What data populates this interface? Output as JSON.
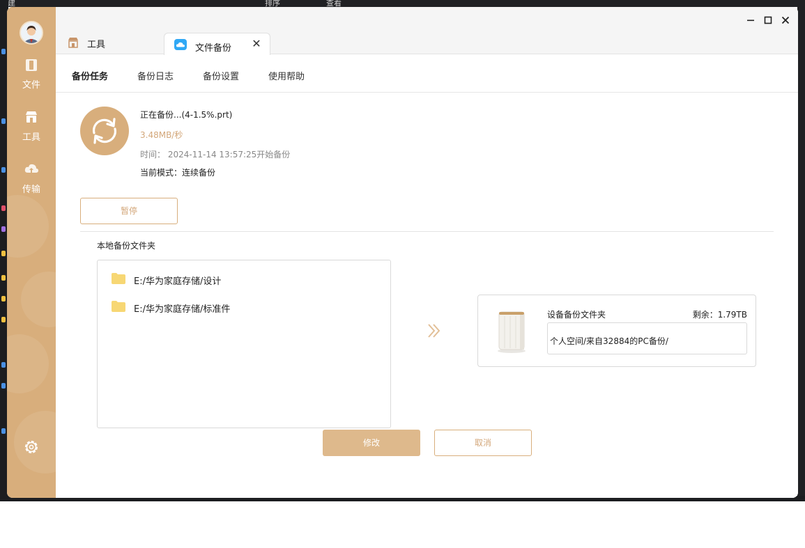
{
  "background": {
    "menu_items": [
      "新建",
      "排序",
      "查看"
    ]
  },
  "sidebar": {
    "items": [
      {
        "label": "文件",
        "icon": "file-icon"
      },
      {
        "label": "工具",
        "icon": "toolbox-icon"
      },
      {
        "label": "传输",
        "icon": "cloud-upload-icon"
      }
    ],
    "settings_icon": "gear-icon",
    "color": "#d8ae7c"
  },
  "tabs": [
    {
      "label": "工具",
      "icon": "store-icon"
    },
    {
      "label": "文件备份",
      "icon": "cloud-icon",
      "active": true
    }
  ],
  "subnav": [
    {
      "label": "备份任务",
      "active": true
    },
    {
      "label": "备份日志"
    },
    {
      "label": "备份设置"
    },
    {
      "label": "使用帮助"
    }
  ],
  "status": {
    "current": "正在备份...(4-1.5%.prt)",
    "speed": "3.48MB/秒",
    "time_label": "时间：",
    "time_value": "2024-11-14 13:57:25开始备份",
    "mode": "当前模式：连续备份"
  },
  "buttons": {
    "pause": "暂停",
    "modify": "修改",
    "cancel": "取消"
  },
  "local_folder": {
    "title": "本地备份文件夹",
    "items": [
      "E:/华为家庭存储/设计",
      "E:/华为家庭存储/标准件"
    ]
  },
  "device_folder": {
    "title": "设备备份文件夹",
    "remaining": "剩余：1.79TB",
    "path": "个人空间/来自32884的PC备份/"
  },
  "colors": {
    "accent": "#d8ae7c",
    "accent_text": "#d3a77a",
    "folder": "#f7d774"
  }
}
